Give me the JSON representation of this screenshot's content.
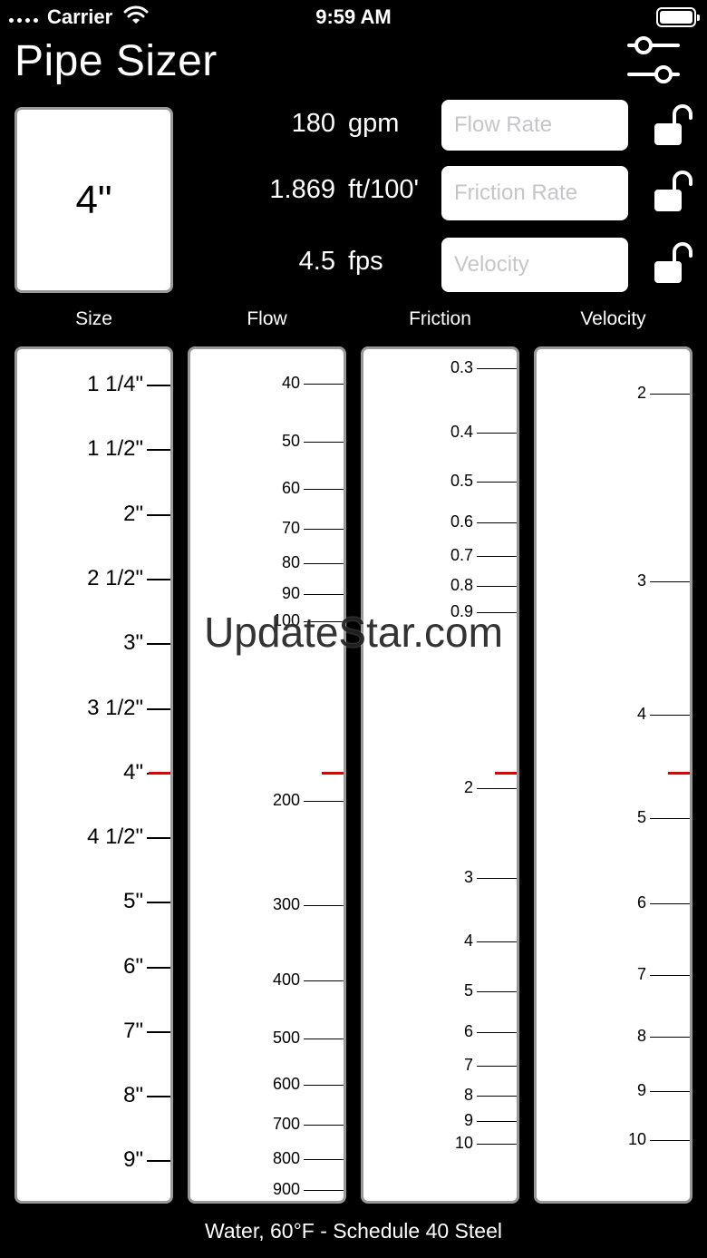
{
  "status_bar": {
    "carrier": "Carrier",
    "time": "9:59 AM"
  },
  "app": {
    "title": "Pipe Sizer"
  },
  "size_display": {
    "value": "4\""
  },
  "inputs": [
    {
      "name": "flow",
      "value": "180",
      "unit": "gpm",
      "placeholder": "Flow Rate",
      "locked": false
    },
    {
      "name": "friction",
      "value": "1.869",
      "unit": "ft/100'",
      "placeholder": "Friction Rate",
      "locked": false
    },
    {
      "name": "velocity",
      "value": "4.5",
      "unit": "fps",
      "placeholder": "Velocity",
      "locked": false
    }
  ],
  "columns": {
    "size": {
      "label": "Size",
      "ticks": [
        "1 1/4\"",
        "1 1/2\"",
        "2\"",
        "2 1/2\"",
        "3\"",
        "3 1/2\"",
        "4\"",
        "4 1/2\"",
        "5\"",
        "6\"",
        "7\"",
        "8\"",
        "9\""
      ]
    },
    "flow": {
      "label": "Flow",
      "ticks": [
        "40",
        "50",
        "60",
        "70",
        "80",
        "90",
        "100",
        "200",
        "300",
        "400",
        "500",
        "600",
        "700",
        "800",
        "900"
      ]
    },
    "friction": {
      "label": "Friction",
      "ticks": [
        "0.3",
        "0.4",
        "0.5",
        "0.6",
        "0.7",
        "0.8",
        "0.9",
        "2",
        "3",
        "4",
        "5",
        "6",
        "7",
        "8",
        "9",
        "10"
      ]
    },
    "velocity": {
      "label": "Velocity",
      "ticks": [
        "2",
        "3",
        "4",
        "5",
        "6",
        "7",
        "8",
        "9",
        "10"
      ]
    }
  },
  "footer": {
    "text": "Water, 60°F - Schedule 40 Steel"
  },
  "watermark": {
    "text": "UpdateStar.com"
  },
  "colors": {
    "marker": "#e00000",
    "background": "#000000",
    "panel": "#ffffff"
  }
}
